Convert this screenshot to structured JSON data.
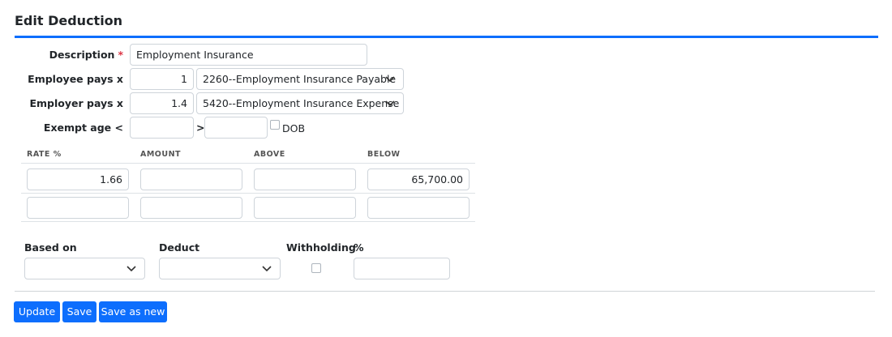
{
  "page": {
    "title": "Edit Deduction"
  },
  "form": {
    "description": {
      "label": "Description",
      "required_mark": "*",
      "value": "Employment Insurance"
    },
    "employee_pays": {
      "label": "Employee pays x",
      "value": "1",
      "account": "2260--Employment Insurance Payable"
    },
    "employer_pays": {
      "label": "Employer pays x",
      "value": "1.4",
      "account": "5420--Employment Insurance Expense"
    },
    "exempt_age": {
      "label": "Exempt age <",
      "separator": ">",
      "lower": "",
      "upper": "",
      "dob_label": "DOB"
    }
  },
  "rates_table": {
    "columns": [
      "RATE %",
      "AMOUNT",
      "ABOVE",
      "BELOW"
    ],
    "rows": [
      [
        "1.66",
        "",
        "",
        "65,700.00"
      ],
      [
        "",
        "",
        "",
        ""
      ]
    ]
  },
  "options": {
    "based_on": {
      "label": "Based on",
      "value": ""
    },
    "deduct": {
      "label": "Deduct",
      "value": ""
    },
    "withholding": {
      "label": "Withholding"
    },
    "percent": {
      "label": "%",
      "value": ""
    }
  },
  "buttons": {
    "update": "Update",
    "save": "Save",
    "save_as_new": "Save as new"
  },
  "colors": {
    "accent": "#0d6efd",
    "required": "#dc3545"
  }
}
